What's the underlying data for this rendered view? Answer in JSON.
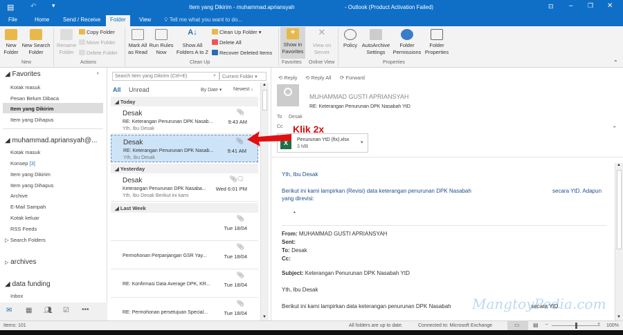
{
  "window": {
    "title_left": "Item yang Dikirim - muhammad.apriansyah",
    "title_right": "- Outlook (Product Activation Failed)"
  },
  "tabs": [
    "File",
    "Home",
    "Send / Receive",
    "Folder",
    "View"
  ],
  "tell_me": "Tell me what you want to do...",
  "ribbon": {
    "new_folder": "New Folder",
    "new_search_folder": "New Search Folder",
    "group_new": "New",
    "rename_folder": "Rename Folder",
    "copy_folder": "Copy Folder",
    "move_folder": "Move Folder",
    "delete_folder": "Delete Folder",
    "group_actions": "Actions",
    "mark_all_read": "Mark All as Read",
    "run_rules": "Run Rules Now",
    "show_all_folders": "Show All Folders A to Z",
    "clean_up_folder": "Clean Up Folder",
    "delete_all": "Delete All",
    "recover_deleted": "Recover Deleted Items",
    "group_clean_up": "Clean Up",
    "show_in_favorites": "Show in Favorites",
    "group_favorites": "Favorites",
    "view_on_server": "View on Server",
    "group_online_view": "Online View",
    "policy": "Policy",
    "autoarchive": "AutoArchive Settings",
    "folder_permissions": "Folder Permissions",
    "folder_properties": "Folder Properties",
    "group_properties": "Properties"
  },
  "nav": {
    "favorites": "Favorites",
    "fav_items": [
      "Kotak masuk",
      "Pesan Belum Dibaca",
      "Item yang Dikirim",
      "Item yang Dihapus"
    ],
    "account": "muhammad.apriansyah@...",
    "account_items": [
      "Kotak masuk",
      "Konsep",
      "Item yang Dikirim",
      "Item yang Dihapus",
      "Archive",
      "E-Mail Sampah",
      "Kotak keluar",
      "RSS Feeds"
    ],
    "konsep_count": "[3]",
    "search_folders": "Search Folders",
    "archives": "archives",
    "data_funding": "data funding",
    "inbox": "Inbox"
  },
  "list": {
    "search_placeholder": "Search Item yang Dikirim (Ctrl+E)",
    "scope": "Current Folder",
    "filter_all": "All",
    "filter_unread": "Unread",
    "sort_by": "By Date",
    "order": "Newest",
    "groups": [
      "Today",
      "Yesterday",
      "Last Week"
    ],
    "messages": [
      {
        "from": "Desak",
        "subject": "RE: Keterangan Penurunan DPK Nasab...",
        "preview": "Yth, Ibu Desak",
        "time": "9:43 AM"
      },
      {
        "from": "Desak",
        "subject": "RE: Keterangan Penurunan DPK Nasab...",
        "preview": "Yth, Ibu Desak",
        "time": "9:41 AM"
      },
      {
        "from": "Desak",
        "subject": "Keterangan Penurunan DPK Nasaba...",
        "preview": "Yth, Ibu Desak  Berikut ini kami",
        "time": "Wed 6:01 PM"
      },
      {
        "from": "",
        "subject": "",
        "preview": "",
        "time": "Tue 18/04"
      },
      {
        "from": "",
        "subject": "Permohonan Perpanjangan GSR Yay...",
        "preview": "",
        "time": "Tue 18/04"
      },
      {
        "from": "",
        "subject": "RE: Konfirmasi Data Average DPK, KR...",
        "preview": "",
        "time": "Tue 18/04"
      },
      {
        "from": "",
        "subject": "RE: Permohonan persetujuan Special...",
        "preview": "",
        "time": "Tue 18/04"
      }
    ]
  },
  "annotation": "Klik 2x",
  "reading": {
    "reply": "Reply",
    "reply_all": "Reply All",
    "forward": "Forward",
    "sender": "MUHAMMAD GUSTI APRIANSYAH",
    "subject": "RE: Keterangan Penurunan DPK Nasabah YtD",
    "to_label": "To",
    "to": "Desak",
    "cc_label": "Cc",
    "attachment_name": "Penurunan YtD (fix).xlsx",
    "attachment_size": "3 MB",
    "greeting": "Yth, Ibu Desak",
    "line1a": "Berikut ini kami lampirkan (Revisi) data keterangan penurunan DPK Nasabah",
    "line1b": "secara YtD. Adapun",
    "line2": "yang direvisi:",
    "from_label": "From:",
    "from_value": "MUHAMMAD GUSTI APRIANSYAH",
    "sent_label": "Sent:",
    "to2_label": "To:",
    "to2_value": "Desak",
    "cc2_label": "Cc:",
    "subject_label": "Subject:",
    "subject_value": "Keterangan Penurunan DPK Nasabah YtD",
    "greeting2": "Yth, Ibu Desak",
    "line3a": "Berikut ini kami lampirkan data keterangan penurunan DPK Nasabah",
    "line3b": "secara YtD."
  },
  "watermark": "MangtoyPedia.com",
  "status": {
    "items": "Items: 101",
    "sync": "All folders are up to date.",
    "connection": "Connected to: Microsoft Exchange",
    "zoom": "100%",
    "zoom_level": 100
  }
}
